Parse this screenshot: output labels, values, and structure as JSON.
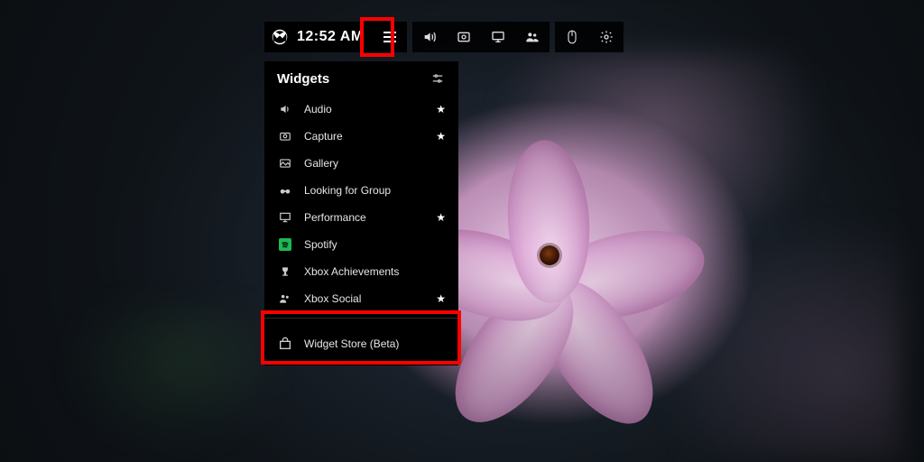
{
  "gamebar": {
    "time": "12:52 AM"
  },
  "widgets": {
    "title": "Widgets",
    "items": {
      "audio": {
        "label": "Audio",
        "pinned": true
      },
      "capture": {
        "label": "Capture",
        "pinned": true
      },
      "gallery": {
        "label": "Gallery",
        "pinned": false
      },
      "lfg": {
        "label": "Looking for Group",
        "pinned": false
      },
      "performance": {
        "label": "Performance",
        "pinned": true
      },
      "spotify": {
        "label": "Spotify",
        "pinned": false
      },
      "achievements": {
        "label": "Xbox Achievements",
        "pinned": false
      },
      "social": {
        "label": "Xbox Social",
        "pinned": true
      },
      "store": {
        "label": "Widget Store (Beta)",
        "pinned": false
      }
    }
  },
  "stars": {
    "on": "★",
    "off": ""
  }
}
